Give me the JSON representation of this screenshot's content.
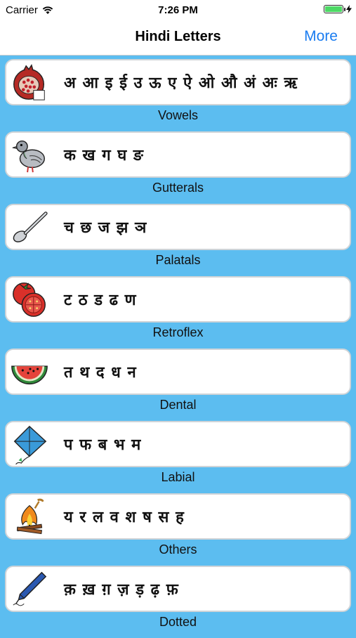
{
  "status": {
    "carrier": "Carrier",
    "time": "7:26 PM",
    "battery_level": 1.0
  },
  "nav": {
    "title": "Hindi Letters",
    "more_label": "More"
  },
  "groups": [
    {
      "letters": "अ आ इ ई उ ऊ ए ऐ ओ औ अं अः ऋ",
      "caption": "Vowels",
      "icon": "pomegranate-icon"
    },
    {
      "letters": "क ख ग घ ङ",
      "caption": "Gutterals",
      "icon": "pigeon-icon"
    },
    {
      "letters": "च छ ज झ ञ",
      "caption": "Palatals",
      "icon": "spoon-icon"
    },
    {
      "letters": "ट ठ ड ढ ण",
      "caption": "Retroflex",
      "icon": "tomato-icon"
    },
    {
      "letters": "त थ द ध न",
      "caption": "Dental",
      "icon": "watermelon-icon"
    },
    {
      "letters": "प फ ब भ म",
      "caption": "Labial",
      "icon": "kite-icon"
    },
    {
      "letters": "य र ल व श ष स ह",
      "caption": "Others",
      "icon": "fire-icon"
    },
    {
      "letters": "क़ ख़ ग़ ज़ ड़ ढ़ फ़",
      "caption": "Dotted",
      "icon": "pen-icon"
    }
  ]
}
